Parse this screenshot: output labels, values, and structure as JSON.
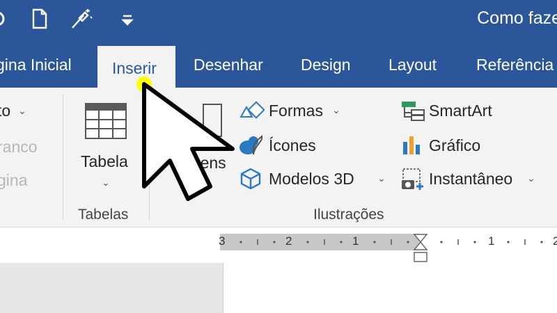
{
  "title_bar": {
    "doc_title": "Como faze"
  },
  "tabs": [
    {
      "label": "gina Inicial"
    },
    {
      "label": "Inserir",
      "active": true
    },
    {
      "label": "Desenhar"
    },
    {
      "label": "Design"
    },
    {
      "label": "Layout"
    },
    {
      "label": "Referência"
    }
  ],
  "ribbon": {
    "left_partial": [
      "to",
      "ranco",
      "gina"
    ],
    "tables": {
      "button": "Tabela",
      "group_label": "Tabelas"
    },
    "images_partial": "agens",
    "illustrations": {
      "formas": "Formas",
      "icones": "Ícones",
      "modelos3d": "Modelos 3D",
      "smartart": "SmartArt",
      "grafico": "Gráfico",
      "instantaneo": "Instantâneo",
      "group_label": "Ilustrações"
    }
  },
  "ruler": [
    "3",
    "2",
    "1",
    "1",
    "2"
  ],
  "colors": {
    "accent": "#2b579a",
    "ribbon_bg": "#f3f3f3",
    "cursor_highlight": "#ffff00"
  }
}
